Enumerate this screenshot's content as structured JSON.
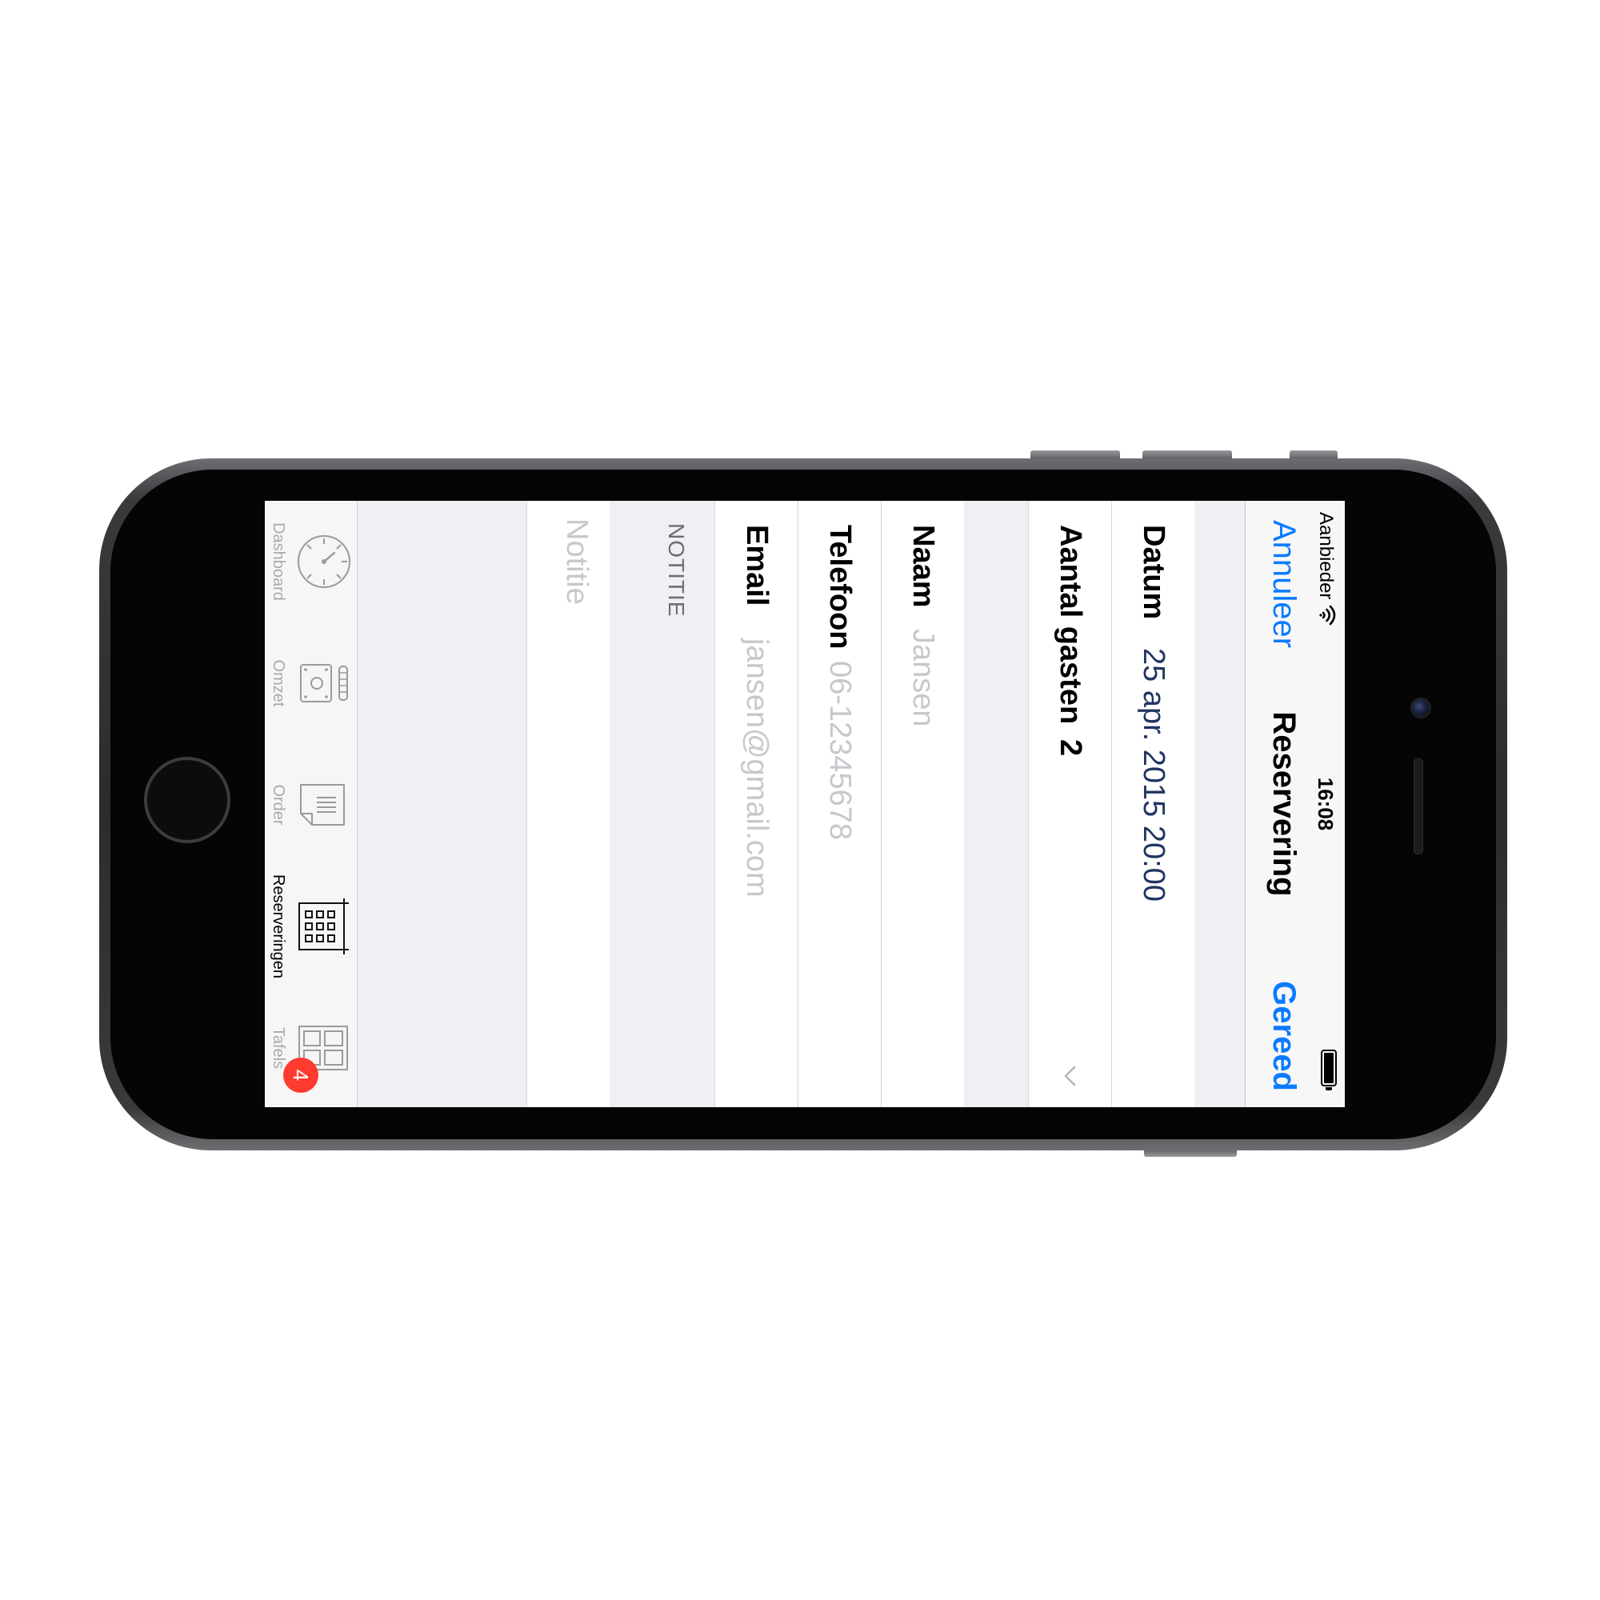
{
  "status_bar": {
    "carrier": "Aanbieder",
    "time": "16:08"
  },
  "nav": {
    "cancel": "Annuleer",
    "title": "Reservering",
    "done": "Gereed"
  },
  "form": {
    "datum": {
      "label": "Datum",
      "value": "25 apr. 2015 20:00"
    },
    "gasten": {
      "label": "Aantal gasten",
      "value": "2"
    },
    "naam": {
      "label": "Naam",
      "placeholder": "Jansen"
    },
    "telefoon": {
      "label": "Telefoon",
      "placeholder": "06-12345678"
    },
    "email": {
      "label": "Email",
      "placeholder": "jansen@gmail.com"
    },
    "notitie_header": "NOTITIE",
    "notitie_placeholder": "Notitie"
  },
  "tabs": [
    {
      "label": "Dashboard",
      "icon": "dashboard-gauge-icon"
    },
    {
      "label": "Omzet",
      "icon": "coins-register-icon"
    },
    {
      "label": "Order",
      "icon": "receipt-icon"
    },
    {
      "label": "Reserveringen",
      "icon": "calendar-icon",
      "active": true
    },
    {
      "label": "Tafels",
      "icon": "tables-grid-icon",
      "badge": "4"
    }
  ],
  "colors": {
    "accent": "#0a7bff",
    "value_dark": "#203562",
    "placeholder": "#c7c7cd",
    "badge": "#ff3b30"
  }
}
